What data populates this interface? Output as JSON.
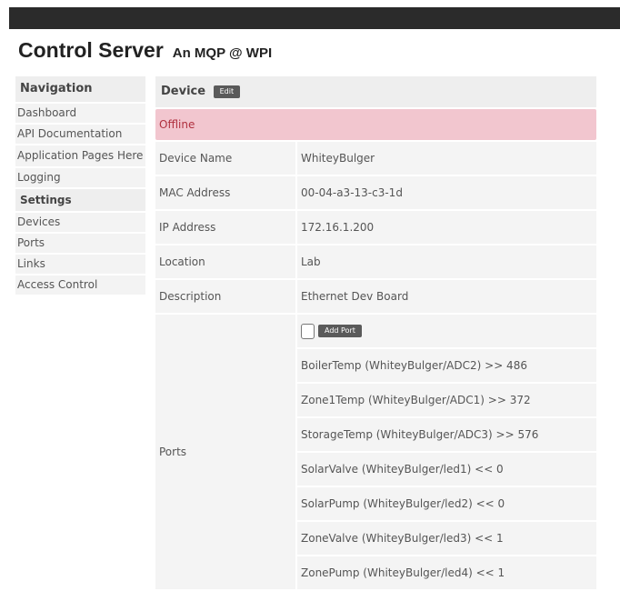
{
  "header": {
    "title": "Control Server",
    "subtitle": "An MQP @ WPI"
  },
  "nav": {
    "heading": "Navigation",
    "items": [
      "Dashboard",
      "API Documentation",
      "Application Pages Here",
      "Logging"
    ],
    "settings_heading": "Settings",
    "settings_items": [
      "Devices",
      "Ports",
      "Links",
      "Access Control"
    ]
  },
  "device": {
    "heading": "Device",
    "edit_label": "Edit",
    "status": "Offline",
    "fields": [
      {
        "label": "Device Name",
        "value": "WhiteyBulger"
      },
      {
        "label": "MAC Address",
        "value": "00-04-a3-13-c3-1d"
      },
      {
        "label": "IP Address",
        "value": "172.16.1.200"
      },
      {
        "label": "Location",
        "value": "Lab"
      },
      {
        "label": "Description",
        "value": "Ethernet Dev Board"
      }
    ],
    "ports_label": "Ports",
    "add_port_label": "Add Port",
    "ports": [
      "BoilerTemp (WhiteyBulger/ADC2) >> 486",
      "Zone1Temp (WhiteyBulger/ADC1) >> 372",
      "StorageTemp (WhiteyBulger/ADC3) >> 576",
      "SolarValve (WhiteyBulger/led1) << 0",
      "SolarPump (WhiteyBulger/led2) << 0",
      "ZoneValve (WhiteyBulger/led3) << 1",
      "ZonePump (WhiteyBulger/led4) << 1"
    ]
  },
  "colors": {
    "topbar": "#2b2b2b",
    "status_bg": "#f2c6cf",
    "status_text": "#b0303f",
    "cell_bg": "#f4f4f4"
  }
}
